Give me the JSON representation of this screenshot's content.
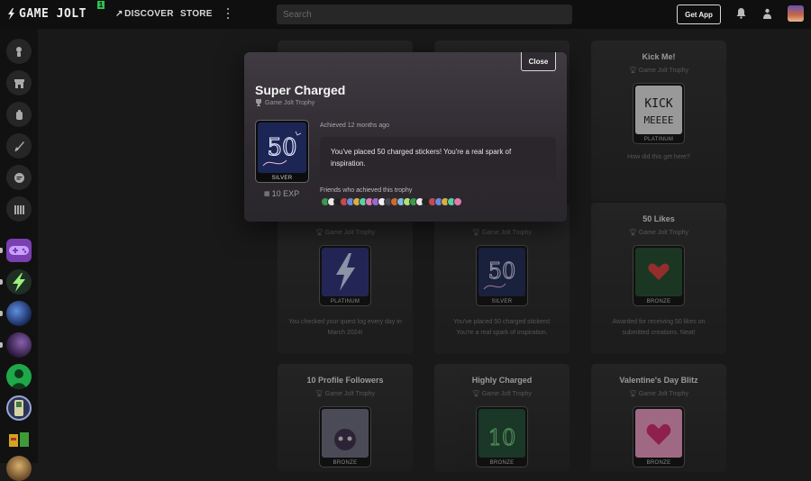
{
  "header": {
    "logo_text": "GAME JOLT",
    "logo_badge": "1",
    "nav_discover": "DISCOVER",
    "nav_store": "STORE",
    "search_placeholder": "Search",
    "get_app": "Get App"
  },
  "cards": [
    {
      "title": "Kick Me!",
      "subtitle": "Game Jolt Trophy",
      "tier": "PLATINUM",
      "description": "How did this get here?",
      "art": "kick"
    },
    {
      "title": "",
      "subtitle": "Game Jolt Trophy",
      "tier": "PLATINUM",
      "description": "You checked your quest log every day in March 2024!",
      "art": "lightning"
    },
    {
      "title": "",
      "subtitle": "Game Jolt Trophy",
      "tier": "SILVER",
      "description": "You've placed 50 charged stickers! You're a real spark of inspiration.",
      "art": "fifty"
    },
    {
      "title": "50 Likes",
      "subtitle": "Game Jolt Trophy",
      "tier": "BRONZE",
      "description": "Awarded for receiving 50 likes on submitted creations. Neat!",
      "art": "heart"
    },
    {
      "title": "10 Profile Followers",
      "subtitle": "Game Jolt Trophy",
      "tier": "BRONZE",
      "description": "",
      "art": "followers"
    },
    {
      "title": "Highly Charged",
      "subtitle": "Game Jolt Trophy",
      "tier": "BRONZE",
      "description": "",
      "art": "ten"
    },
    {
      "title": "Valentine's Day Blitz",
      "subtitle": "Game Jolt Trophy",
      "tier": "BRONZE",
      "description": "",
      "art": "valentine"
    }
  ],
  "modal": {
    "close_label": "Close",
    "title": "Super Charged",
    "subtitle": "Game Jolt Trophy",
    "tier": "SILVER",
    "exp": "10 EXP",
    "achieved": "Achieved 12 months ago",
    "description": "You've placed 50 charged stickers! You're a real spark of inspiration.",
    "friends_label": "Friends who achieved this trophy",
    "friend_count": 22
  },
  "colors": {
    "accent_green": "#2fbf4f",
    "modal_bg": "#403b42",
    "card_bg": "#2b2b2b"
  }
}
